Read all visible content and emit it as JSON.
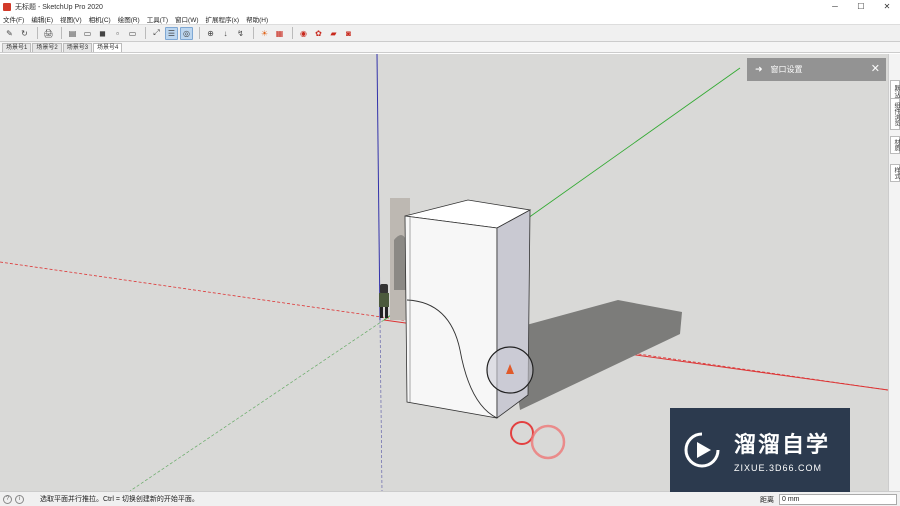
{
  "window": {
    "title": "无标题 - SketchUp Pro 2020",
    "controls": [
      "─",
      "☐",
      "✕"
    ]
  },
  "menu": [
    "文件(F)",
    "编辑(E)",
    "视图(V)",
    "相机(C)",
    "绘图(R)",
    "工具(T)",
    "窗口(W)",
    "扩展程序(x)",
    "帮助(H)"
  ],
  "toolbar": {
    "buttons": [
      "✎",
      "↻",
      "🖨",
      "▤",
      "▭",
      "◼",
      "▫",
      "▭",
      "⤢",
      "☰",
      "◎",
      "⊕",
      "↓",
      "↯",
      "☀",
      "▦",
      "◉",
      "✿",
      "▰",
      "◙"
    ]
  },
  "scenes": [
    "场景号1",
    "场景号2",
    "场景号3",
    "场景号4"
  ],
  "active_scene": "场景号4",
  "tray": {
    "title": "窗口设置"
  },
  "right_tabs": [
    "默认面板",
    "组件浏览",
    "材质",
    "样式"
  ],
  "status": {
    "hint": "选取平面并行推拉。Ctrl = 切换创建新的开始平面。",
    "measure_label": "距离",
    "measure_value": "0 mm"
  },
  "watermark": {
    "cn": "溜溜自学",
    "url": "ZIXUE.3D66.COM"
  },
  "colors": {
    "axis_red": "#d33",
    "axis_green": "#3a3",
    "axis_blue": "#33a",
    "viewport_bg": "#d9d9d7",
    "watermark_bg": "#1e2d44"
  }
}
